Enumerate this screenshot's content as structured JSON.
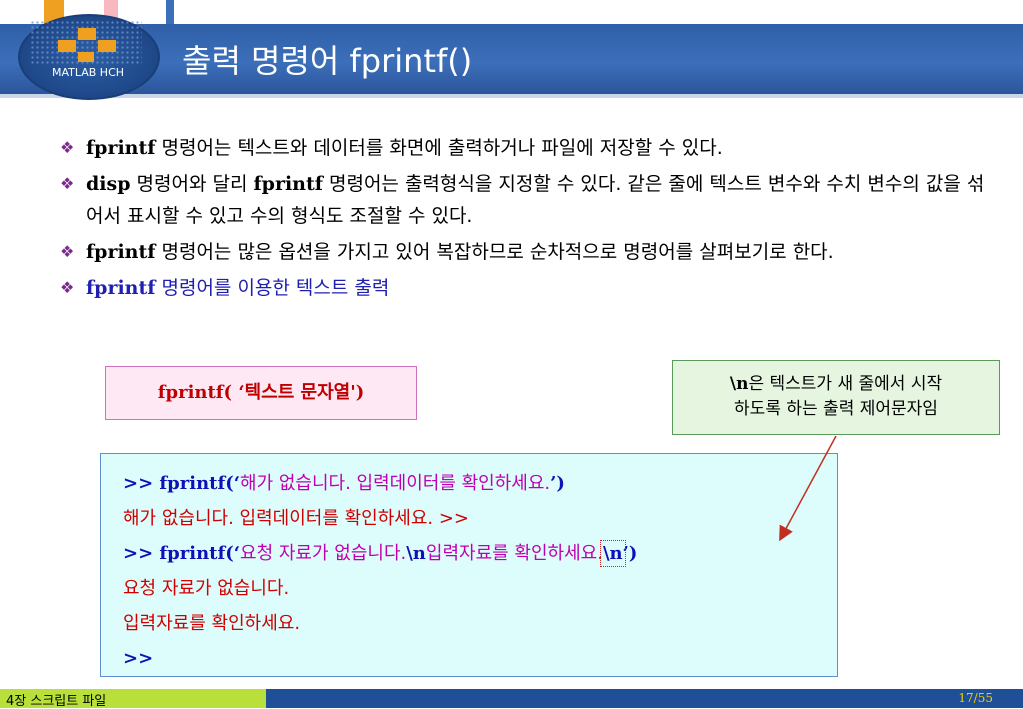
{
  "header": {
    "title": "출력 명령어 fprintf()",
    "logo_text": "MATLAB HCH"
  },
  "bullets": [
    {
      "bold": "fprintf",
      "text": " 명령어는 텍스트와 데이터를 화면에 출력하거나 파일에 저장할 수 있다."
    },
    {
      "bold": "disp",
      "text": " 명령어와 달리 ",
      "bold2": "fprintf",
      "text2": " 명령어는 출력형식을 지정할 수 있다. 같은 줄에 텍스트 변수와 수치 변수의 값을 섞어서 표시할 수 있고 수의 형식도 조절할 수 있다."
    },
    {
      "bold": "fprintf",
      "text": " 명령어는 많은 옵션을 가지고 있어 복잡하므로 순차적으로 명령어를 살펴보기로 한다."
    },
    {
      "bold": "fprintf",
      "text": " 명령어를 이용한 텍스트 출력"
    }
  ],
  "syntax_box": {
    "text": "fprintf( ‘텍스트 문자열')"
  },
  "note_box": {
    "bold": "\\n",
    "line1": "은 텍스트가 새 줄에서 시작",
    "line2": "하도록 하는 출력 제어문자임"
  },
  "command": {
    "l1_prefix": ">> fprintf(‘",
    "l1_str": "해가 없습니다. 입력데이터를 확인하세요.",
    "l1_suffix": "’)",
    "l2": "해가 없습니다. 입력데이터를 확인하세요. >>",
    "l3_prefix": ">> fprintf(‘",
    "l3_str1": "요청 자료가 없습니다.",
    "l3_nl1": "\\n",
    "l3_str2": "입력자료를 확인하세요.",
    "l3_nl2": "\\n",
    "l3_suffix": "’)",
    "l4": "요청 자료가 없습니다.",
    "l5": "입력자료를 확인하세요.",
    "l6": ">>"
  },
  "footer": {
    "chapter": "4장 스크립트 파일",
    "page": "17/55"
  },
  "colors": {
    "header": "#3c6fba",
    "accent_green": "#b8df3a",
    "command_blue": "#1010b8",
    "string_magenta": "#c000b0"
  }
}
